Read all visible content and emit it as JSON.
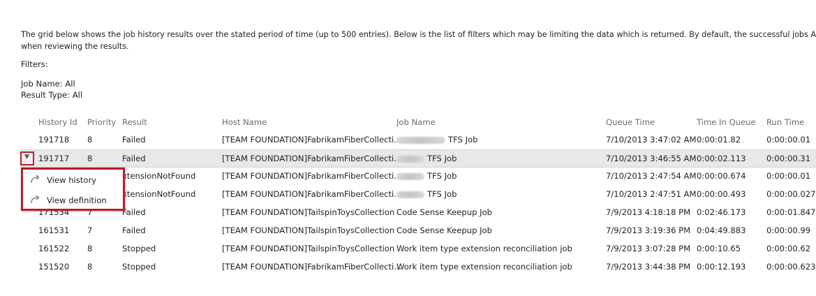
{
  "intro": {
    "line1": "The grid below shows the job history results over the stated period of time (up to 500 entries). Below is the list of filters which may be limiting the data which is returned. By default, the successful jobs ARE NOT shown",
    "line2": "when reviewing the results."
  },
  "filters": {
    "label": "Filters:",
    "job_name": "Job Name: All",
    "result_type": "Result Type: All"
  },
  "grid": {
    "columns": [
      "History Id",
      "Priority",
      "Result",
      "Host Name",
      "Job Name",
      "Queue Time",
      "Time In Queue",
      "Run Time"
    ],
    "rows": [
      {
        "history_id": "191718",
        "priority": "8",
        "result": "Failed",
        "host": "[TEAM FOUNDATION]FabrikamFiberCollecti...",
        "job": "TFS Job",
        "queue_time": "7/10/2013 3:47:02 AM",
        "time_in_queue": "0:00:01.82",
        "run_time": "0:00:00.01"
      },
      {
        "history_id": "191717",
        "priority": "8",
        "result": "Failed",
        "host": "[TEAM FOUNDATION]FabrikamFiberCollecti...",
        "job": "TFS Job",
        "queue_time": "7/10/2013 3:46:55 AM",
        "time_in_queue": "0:00:02.113",
        "run_time": "0:00:00.31"
      },
      {
        "history_id": "",
        "priority": "",
        "result": "xtensionNotFound",
        "host": "[TEAM FOUNDATION]FabrikamFiberCollecti...",
        "job": "TFS Job",
        "queue_time": "7/10/2013 2:47:54 AM",
        "time_in_queue": "0:00:00.674",
        "run_time": "0:00:00.01"
      },
      {
        "history_id": "",
        "priority": "",
        "result": "xtensionNotFound",
        "host": "[TEAM FOUNDATION]FabrikamFiberCollecti...",
        "job": "TFS Job",
        "queue_time": "7/10/2013 2:47:51 AM",
        "time_in_queue": "0:00:00.493",
        "run_time": "0:00:00.027"
      },
      {
        "history_id": "171534",
        "priority": "7",
        "result": "Failed",
        "host": "[TEAM FOUNDATION]TailspinToysCollection",
        "job": "Code Sense Keepup Job",
        "queue_time": "7/9/2013 4:18:18 PM",
        "time_in_queue": "0:02:46.173",
        "run_time": "0:00:01.847"
      },
      {
        "history_id": "161531",
        "priority": "7",
        "result": "Failed",
        "host": "[TEAM FOUNDATION]TailspinToysCollection",
        "job": "Code Sense Keepup Job",
        "queue_time": "7/9/2013 3:19:36 PM",
        "time_in_queue": "0:04:49.883",
        "run_time": "0:00:00.99"
      },
      {
        "history_id": "161522",
        "priority": "8",
        "result": "Stopped",
        "host": "[TEAM FOUNDATION]TailspinToysCollection",
        "job": "Work item type extension reconciliation job",
        "queue_time": "7/9/2013 3:07:28 PM",
        "time_in_queue": "0:00:10.65",
        "run_time": "0:00:00.62"
      },
      {
        "history_id": "151520",
        "priority": "8",
        "result": "Stopped",
        "host": "[TEAM FOUNDATION]FabrikamFiberCollecti...",
        "job": "Work item type extension reconciliation job",
        "queue_time": "7/9/2013 3:44:38 PM",
        "time_in_queue": "0:00:12.193",
        "run_time": "0:00:00.623"
      }
    ]
  },
  "context_menu": {
    "items": [
      {
        "label": "View history",
        "icon": "redo-arrow-icon"
      },
      {
        "label": "View definition",
        "icon": "redo-arrow-icon"
      }
    ]
  },
  "colors": {
    "highlight_border": "#b81d28",
    "selected_row": "#e8e8e8",
    "header_text": "#6b6b6b"
  }
}
